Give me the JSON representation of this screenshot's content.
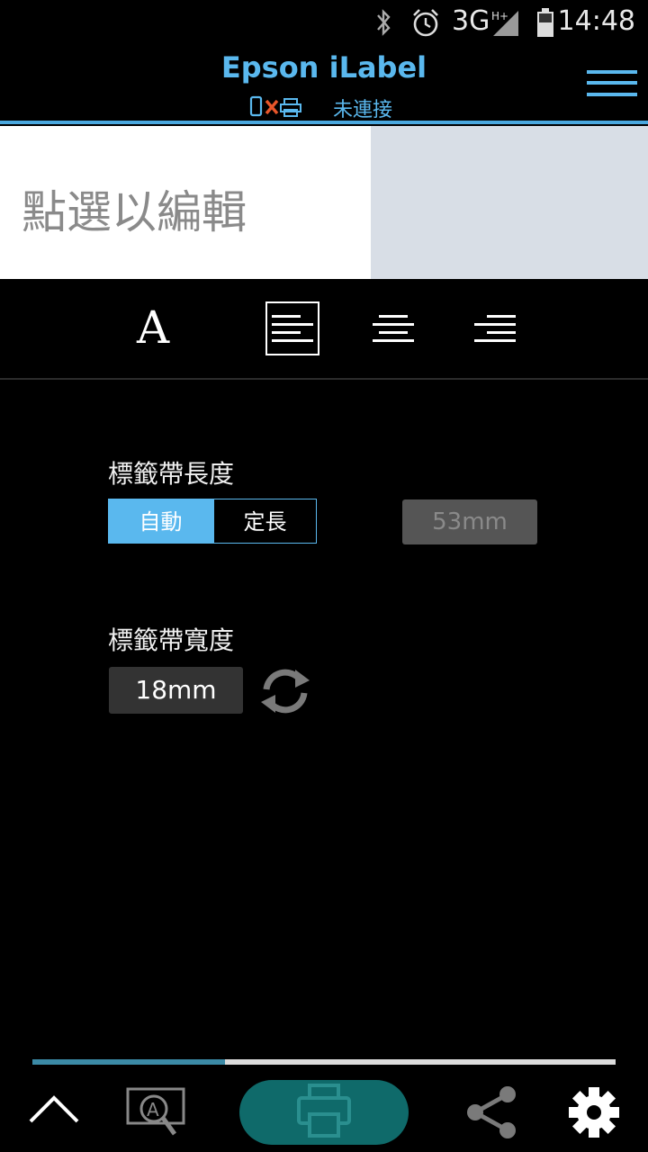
{
  "status_bar": {
    "network": "3G",
    "time": "14:48"
  },
  "header": {
    "title": "Epson iLabel",
    "connection_status": "未連接"
  },
  "preview": {
    "placeholder": "點選以編輯"
  },
  "toolbar": {
    "font_glyph": "A",
    "align_options": [
      "left",
      "center",
      "right"
    ],
    "selected_align": "left"
  },
  "settings": {
    "tape_length": {
      "label": "標籤帶長度",
      "mode_auto": "自動",
      "mode_fixed": "定長",
      "selected_mode": "auto",
      "value": "53mm"
    },
    "tape_width": {
      "label": "標籤帶寬度",
      "value": "18mm"
    }
  },
  "bottom": {
    "progress_fraction": 0.33
  },
  "colors": {
    "accent": "#5ab8ee",
    "print_button": "#0f6a6a",
    "progress": "#3b8aa6"
  }
}
